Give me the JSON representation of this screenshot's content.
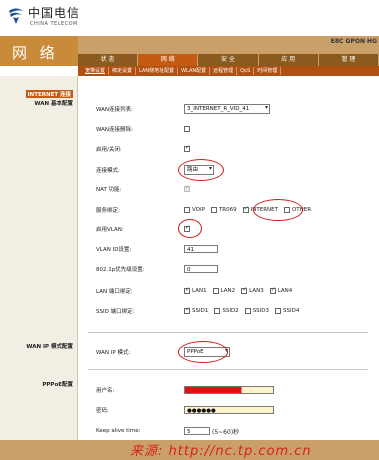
{
  "brand": {
    "name_cn": "中国电信",
    "name_en": "CHINA TELECOM"
  },
  "header": {
    "title": "网 络",
    "device": "E8C GPON HG"
  },
  "nav": [
    {
      "label": "状 态",
      "active": false
    },
    {
      "label": "网 络",
      "active": true
    },
    {
      "label": "安 全",
      "active": false
    },
    {
      "label": "应 用",
      "active": false
    },
    {
      "label": "管 理",
      "active": false
    }
  ],
  "subnav": [
    {
      "label": "宽带设置",
      "active": true
    },
    {
      "label": "绑定设置",
      "active": false
    },
    {
      "label": "LAN侧地址配置",
      "active": false
    },
    {
      "label": "WLAN配置",
      "active": false
    },
    {
      "label": "远程管理",
      "active": false
    },
    {
      "label": "QoS",
      "active": false
    },
    {
      "label": "时间管理",
      "active": false
    }
  ],
  "sidebar": {
    "internet": "INTERNET 连接",
    "wan_basic": "WAN 基本配置",
    "wan_ip_mode": "WAN IP 模式配置",
    "pppoe": "PPPoE配置"
  },
  "form": {
    "wan_list_label": "WAN连接列表:",
    "wan_list_value": "3_INTERNET_R_VID_41",
    "wan_delete_label": "WAN连接删除:",
    "enable_label": "启用/关闭:",
    "mode_label": "连接模式:",
    "mode_value": "路由",
    "nat_label": "NAT 功能:",
    "service_label": "服务绑定:",
    "service_options": [
      "VOIP",
      "TR069",
      "INTERNET",
      "OTHER"
    ],
    "vlan_enable_label": "启用VLAN:",
    "vlan_id_label": "VLAN ID设置:",
    "vlan_id_value": "41",
    "priority_label": "802.1p优先级设置:",
    "priority_value": "0",
    "lan_bind_label": "LAN 端口绑定:",
    "lan_ports": [
      "LAN1",
      "LAN2",
      "LAN3",
      "LAN4"
    ],
    "ssid_bind_label": "SSID 端口绑定:",
    "ssids": [
      "SSID1",
      "SSID2",
      "SSID3",
      "SSID4"
    ],
    "wan_ip_mode_label": "WAN IP 模式:",
    "wan_ip_mode_value": "PPPoE",
    "username_label": "用户名:",
    "password_label": "密码:",
    "password_value": "●●●●●●",
    "keepalive_label": "Keep alive time:",
    "keepalive_value": "5",
    "keepalive_hint": "(5~60)秒"
  },
  "watermark": "来源: http://nc.tp.com.cn",
  "colors": {
    "accent": "#c55a12",
    "header": "#c9a06a",
    "annotation": "#d01818"
  }
}
